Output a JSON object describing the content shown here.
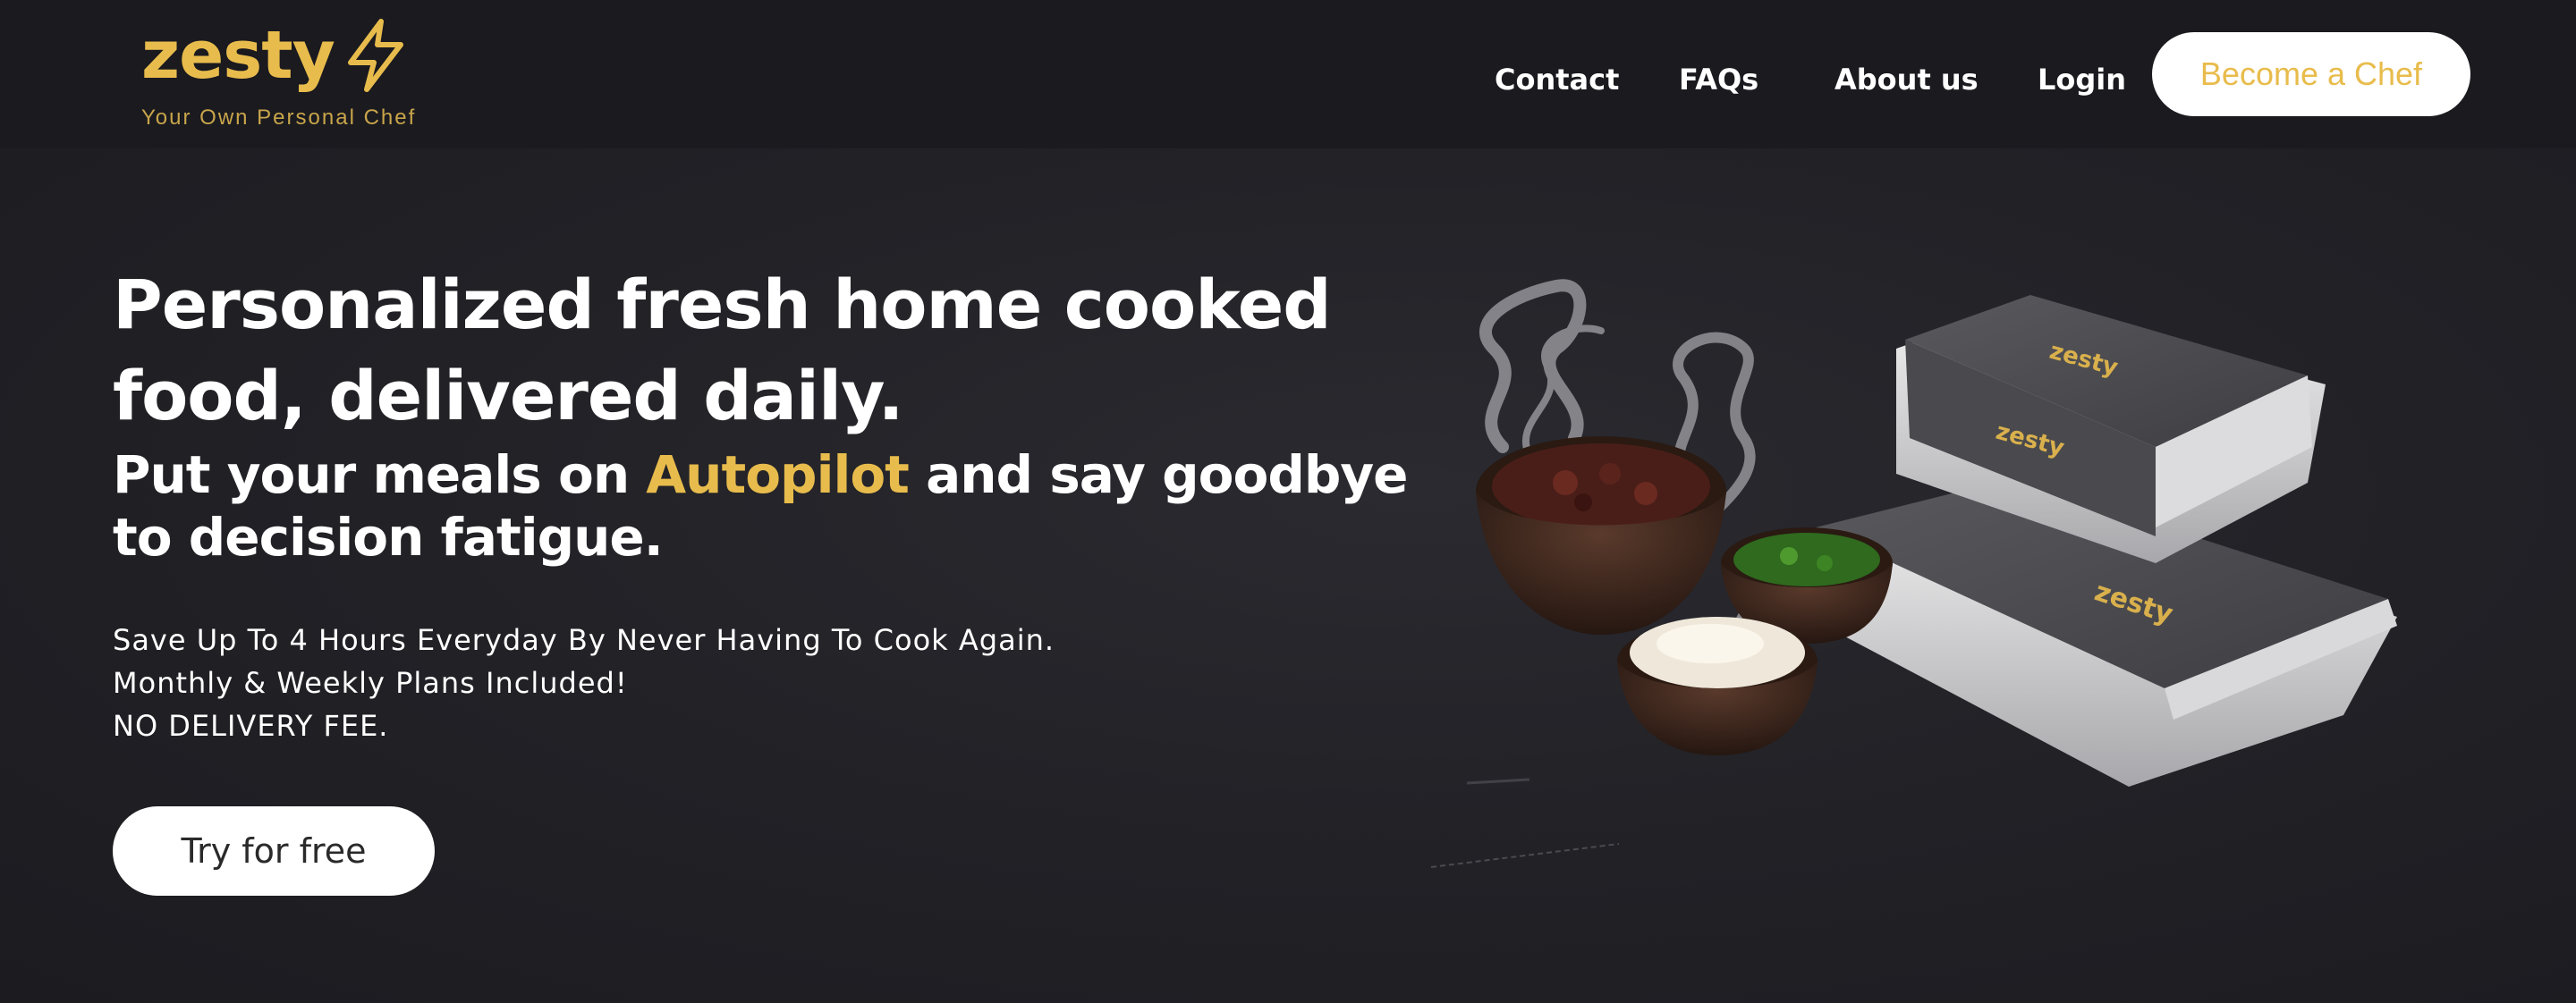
{
  "brand": {
    "name": "zesty",
    "tagline": "Your Own Personal Chef",
    "accent_color": "#e8bc4c"
  },
  "nav": {
    "links": [
      {
        "label": "Contact"
      },
      {
        "label": "FAQs"
      },
      {
        "label": "About us"
      },
      {
        "label": "Login"
      }
    ],
    "cta_label": "Become a Chef"
  },
  "hero": {
    "headline": "Personalized fresh home cooked food, delivered daily.",
    "subhead_before": "Put your meals on ",
    "subhead_accent": "Autopilot",
    "subhead_after": " and say goodbye to decision fatigue.",
    "benefits": [
      "Save Up To 4 Hours Everyday By Never Having To Cook Again.",
      "Monthly & Weekly Plans Included!",
      "NO DELIVERY FEE."
    ],
    "cta_label": "Try for free",
    "image_alt_icon": "food-delivery-image"
  }
}
